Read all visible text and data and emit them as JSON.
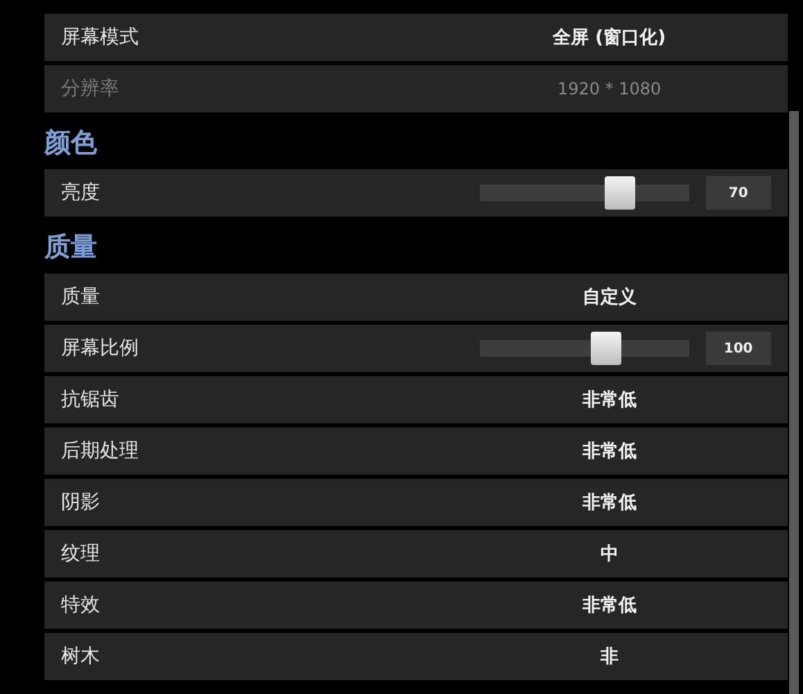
{
  "sections": [
    {
      "rows": [
        {
          "kind": "choice",
          "label": "屏幕模式",
          "value": "全屏 (窗口化)",
          "disabled": false
        },
        {
          "kind": "choice",
          "label": "分辨率",
          "value": "1920 * 1080",
          "disabled": true
        }
      ]
    },
    {
      "heading": "颜色",
      "rows": [
        {
          "kind": "slider",
          "label": "亮度",
          "level": 0.7,
          "reading": "70",
          "disabled": false
        }
      ]
    },
    {
      "heading": "质量",
      "rows": [
        {
          "kind": "choice",
          "label": "质量",
          "value": "自定义",
          "disabled": false
        },
        {
          "kind": "slider",
          "label": "屏幕比例",
          "level": 0.62,
          "reading": "100",
          "disabled": false
        },
        {
          "kind": "choice",
          "label": "抗锯齿",
          "value": "非常低",
          "disabled": false
        },
        {
          "kind": "choice",
          "label": "后期处理",
          "value": "非常低",
          "disabled": false
        },
        {
          "kind": "choice",
          "label": "阴影",
          "value": "非常低",
          "disabled": false
        },
        {
          "kind": "choice",
          "label": "纹理",
          "value": "中",
          "disabled": false
        },
        {
          "kind": "choice",
          "label": "特效",
          "value": "非常低",
          "disabled": false
        },
        {
          "kind": "choice",
          "label": "树木",
          "value": "非",
          "disabled": false
        }
      ]
    }
  ]
}
